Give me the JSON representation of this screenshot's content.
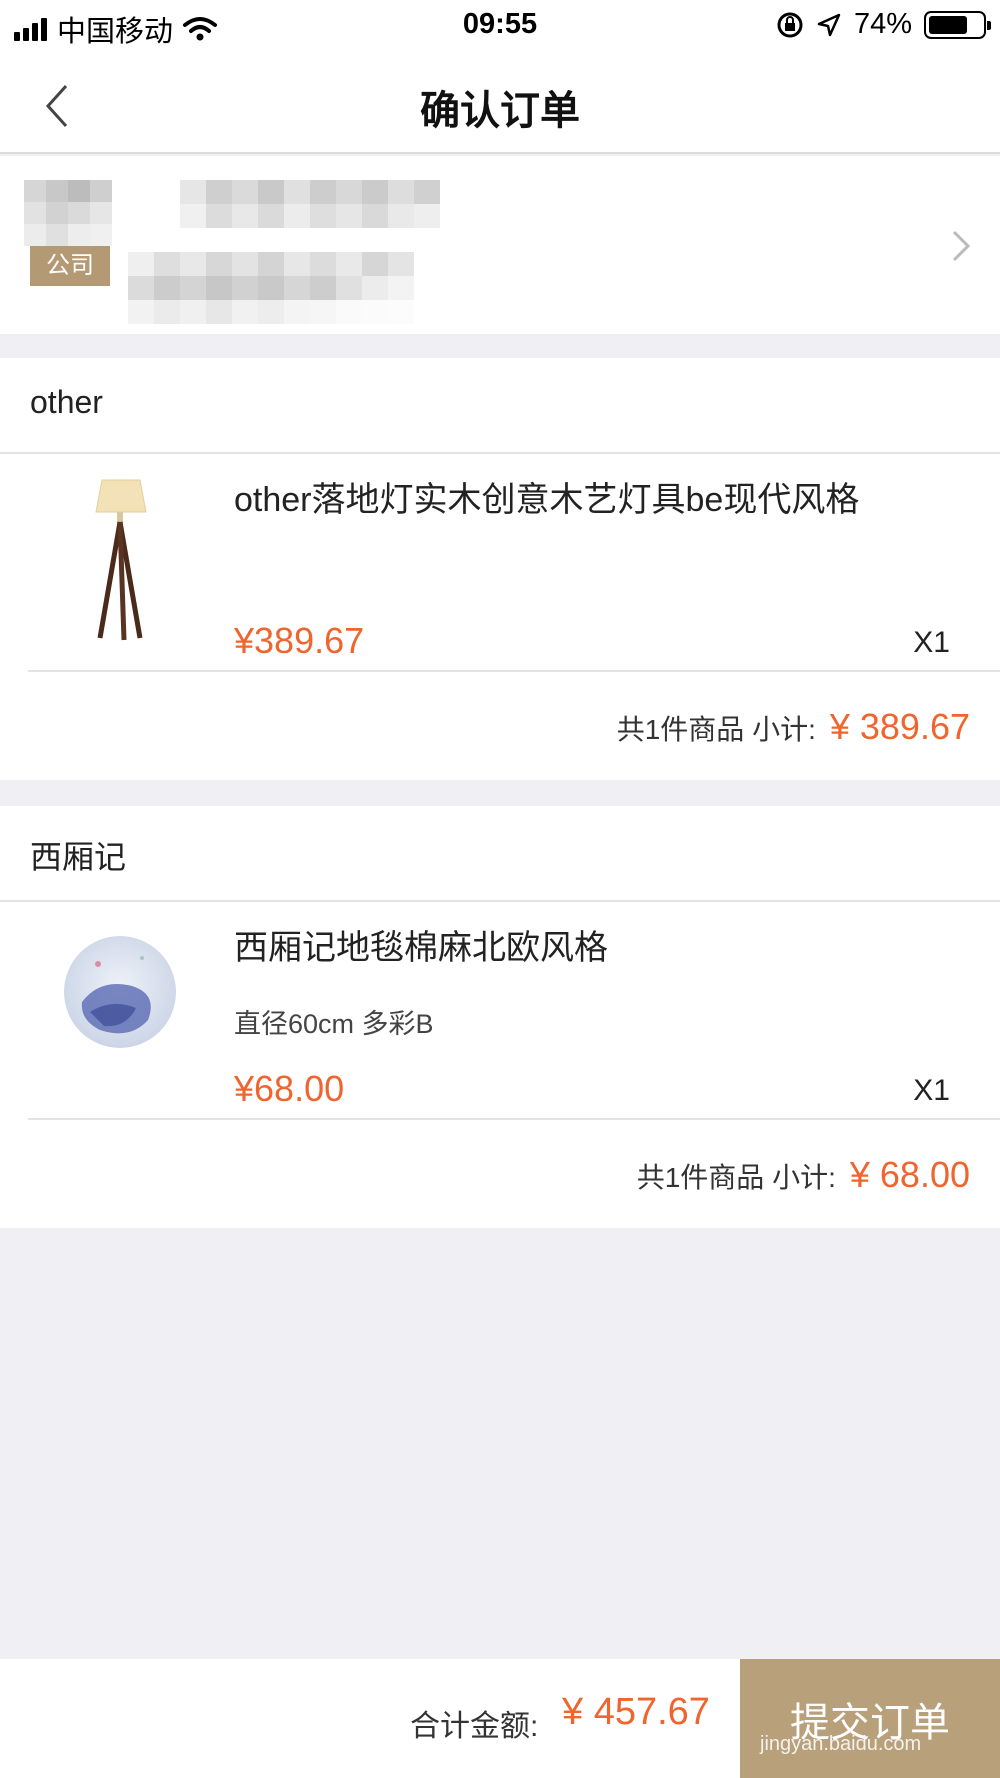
{
  "status_bar": {
    "carrier": "中国移动",
    "time": "09:55",
    "battery": "74%",
    "battery_level": 0.74,
    "icons": [
      "signal-icon",
      "wifi-icon",
      "orientation-lock-icon",
      "location-icon",
      "battery-icon"
    ]
  },
  "nav": {
    "title": "确认订单",
    "back_icon": "chevron-left-icon"
  },
  "address": {
    "tag": "公司",
    "arrow_icon": "chevron-right-icon"
  },
  "shops": [
    {
      "name": "other",
      "items": [
        {
          "title": "other落地灯实木创意木艺灯具be现代风格",
          "spec": "",
          "price": "¥389.67",
          "qty": "X1",
          "image": "floor-lamp-image"
        }
      ],
      "subtotal_label": "共1件商品 小计:",
      "subtotal_amount": "¥ 389.67"
    },
    {
      "name": "西厢记",
      "items": [
        {
          "title": "西厢记地毯棉麻北欧风格",
          "spec": "直径60cm  多彩B",
          "price": "¥68.00",
          "qty": "X1",
          "image": "round-rug-image"
        }
      ],
      "subtotal_label": "共1件商品 小计:",
      "subtotal_amount": "¥ 68.00"
    }
  ],
  "footer": {
    "total_label": "合计金额:",
    "total_amount": "¥ 457.67",
    "submit_label": "提交订单",
    "watermark": "jingyan.baidu.com"
  },
  "colors": {
    "accent_price": "#f0642d",
    "submit_bg": "#b8a07a",
    "tag_bg": "#b49a74",
    "page_bg": "#efeff4"
  }
}
